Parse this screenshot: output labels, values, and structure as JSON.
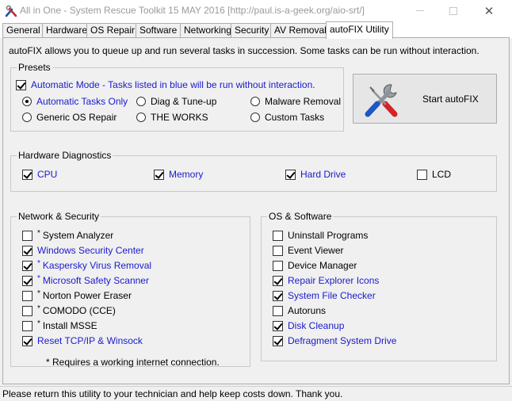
{
  "window": {
    "title": "All in One - System Rescue Toolkit 15 MAY 2016 [http://paul.is-a-geek.org/aio-srt/]",
    "close_glyph": "✕"
  },
  "tabs": [
    {
      "label": "General"
    },
    {
      "label": "Hardware"
    },
    {
      "label": "OS Repair"
    },
    {
      "label": "Software"
    },
    {
      "label": "Networking"
    },
    {
      "label": "Security"
    },
    {
      "label": "AV Removal"
    },
    {
      "label": "autoFIX Utility",
      "active": true
    }
  ],
  "intro": "autoFIX allows you to queue up and run several tasks in succession.  Some tasks can be run without interaction.",
  "presets": {
    "title": "Presets",
    "automatic_mode": {
      "label": "Automatic Mode - Tasks listed in blue will be run without interaction.",
      "checked": true
    },
    "options": [
      {
        "label": "Automatic Tasks Only",
        "selected": true,
        "blue": true
      },
      {
        "label": "Diag & Tune-up",
        "selected": false
      },
      {
        "label": "Malware Removal",
        "selected": false
      },
      {
        "label": "Generic OS Repair",
        "selected": false
      },
      {
        "label": "THE WORKS",
        "selected": false
      },
      {
        "label": "Custom Tasks",
        "selected": false
      }
    ]
  },
  "start_button": {
    "label": "Start autoFIX",
    "icon": "tools-icon"
  },
  "hardware": {
    "title": "Hardware Diagnostics",
    "items": [
      {
        "label": "CPU",
        "checked": true,
        "blue": true
      },
      {
        "label": "Memory",
        "checked": true,
        "blue": true
      },
      {
        "label": "Hard Drive",
        "checked": true,
        "blue": true
      },
      {
        "label": "LCD",
        "checked": false,
        "blue": false
      }
    ]
  },
  "network": {
    "title": "Network & Security",
    "items": [
      {
        "label": "System Analyzer",
        "checked": false,
        "blue": false,
        "star": "*"
      },
      {
        "label": "Windows Security Center",
        "checked": true,
        "blue": true,
        "star": ""
      },
      {
        "label": "Kaspersky Virus Removal",
        "checked": true,
        "blue": true,
        "star": "*"
      },
      {
        "label": "Microsoft Safety Scanner",
        "checked": true,
        "blue": true,
        "star": "*"
      },
      {
        "label": "Norton Power Eraser",
        "checked": false,
        "blue": false,
        "star": "*"
      },
      {
        "label": "COMODO (CCE)",
        "checked": false,
        "blue": false,
        "star": "*"
      },
      {
        "label": "Install MSSE",
        "checked": false,
        "blue": false,
        "star": "*"
      },
      {
        "label": "Reset TCP/IP & Winsock",
        "checked": true,
        "blue": true,
        "star": ""
      }
    ],
    "footnote": "* Requires a working internet connection."
  },
  "os": {
    "title": "OS & Software",
    "items": [
      {
        "label": "Uninstall Programs",
        "checked": false,
        "blue": false
      },
      {
        "label": "Event Viewer",
        "checked": false,
        "blue": false
      },
      {
        "label": "Device Manager",
        "checked": false,
        "blue": false
      },
      {
        "label": "Repair Explorer Icons",
        "checked": true,
        "blue": true
      },
      {
        "label": "System File Checker",
        "checked": true,
        "blue": true
      },
      {
        "label": "Autoruns",
        "checked": false,
        "blue": false
      },
      {
        "label": "Disk Cleanup",
        "checked": true,
        "blue": true
      },
      {
        "label": "Defragment System Drive",
        "checked": true,
        "blue": true
      }
    ]
  },
  "status": "Please return this utility to your technician and help keep costs down. Thank you.",
  "colors": {
    "blue_task": "#1a1acd",
    "background": "#f0f0f0"
  }
}
